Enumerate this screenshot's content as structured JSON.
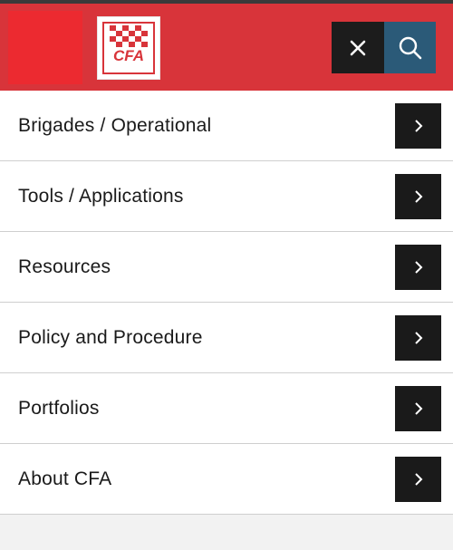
{
  "brand": {
    "logo_text": "CFA",
    "logo_alt": "CFA logo",
    "colors": {
      "header": "#d8343a",
      "accent_block": "#ec2a30",
      "search": "#2b5a78",
      "dark": "#1c1c1c"
    }
  },
  "header": {
    "close_icon": "close-icon",
    "search_icon": "search-icon"
  },
  "menu": {
    "items": [
      {
        "label": "Brigades / Operational",
        "icon": "chevron-right-icon"
      },
      {
        "label": "Tools / Applications",
        "icon": "chevron-right-icon"
      },
      {
        "label": "Resources",
        "icon": "chevron-right-icon"
      },
      {
        "label": "Policy and Procedure",
        "icon": "chevron-right-icon"
      },
      {
        "label": "Portfolios",
        "icon": "chevron-right-icon"
      },
      {
        "label": "About CFA",
        "icon": "chevron-right-icon"
      }
    ]
  }
}
